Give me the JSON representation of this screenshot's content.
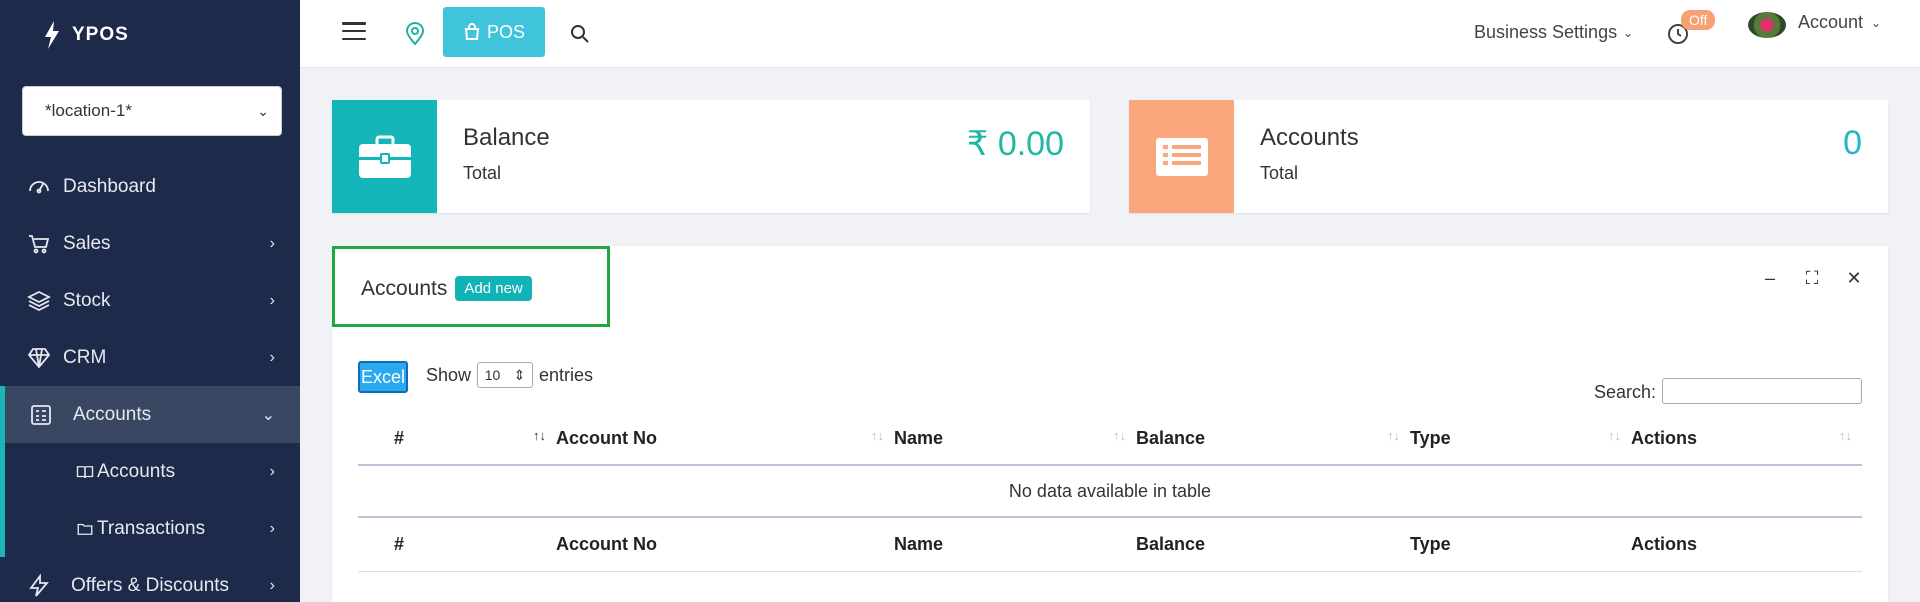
{
  "brand": {
    "name": "YPOS"
  },
  "location_select": {
    "value": "*location-1*"
  },
  "sidebar": {
    "items": [
      {
        "label": "Dashboard",
        "icon": "gauge-icon"
      },
      {
        "label": "Sales",
        "icon": "cart-icon"
      },
      {
        "label": "Stock",
        "icon": "layers-icon"
      },
      {
        "label": "CRM",
        "icon": "diamond-icon"
      },
      {
        "label": "Accounts",
        "icon": "ledger-icon"
      },
      {
        "label": "Accounts",
        "icon": "book-icon"
      },
      {
        "label": "Transactions",
        "icon": "folder-icon"
      },
      {
        "label": "Offers & Discounts",
        "icon": "bolt-icon"
      }
    ]
  },
  "topbar": {
    "pos_label": "POS",
    "business_settings": "Business Settings",
    "off_badge": "Off",
    "account_label": "Account"
  },
  "info_boxes": [
    {
      "title": "Balance",
      "subtitle": "Total",
      "value": "₹ 0.00",
      "color": "#14b5b9"
    },
    {
      "title": "Accounts",
      "subtitle": "Total",
      "value": "0",
      "color": "#fba77d"
    }
  ],
  "card": {
    "title": "Accounts",
    "add_new": "Add new",
    "excel": "Excel",
    "show": "Show",
    "page_size": "10",
    "entries": "entries",
    "search_label": "Search:",
    "columns": [
      "#",
      "Account No",
      "Name",
      "Balance",
      "Type",
      "Actions"
    ],
    "empty_message": "No data available in table"
  }
}
